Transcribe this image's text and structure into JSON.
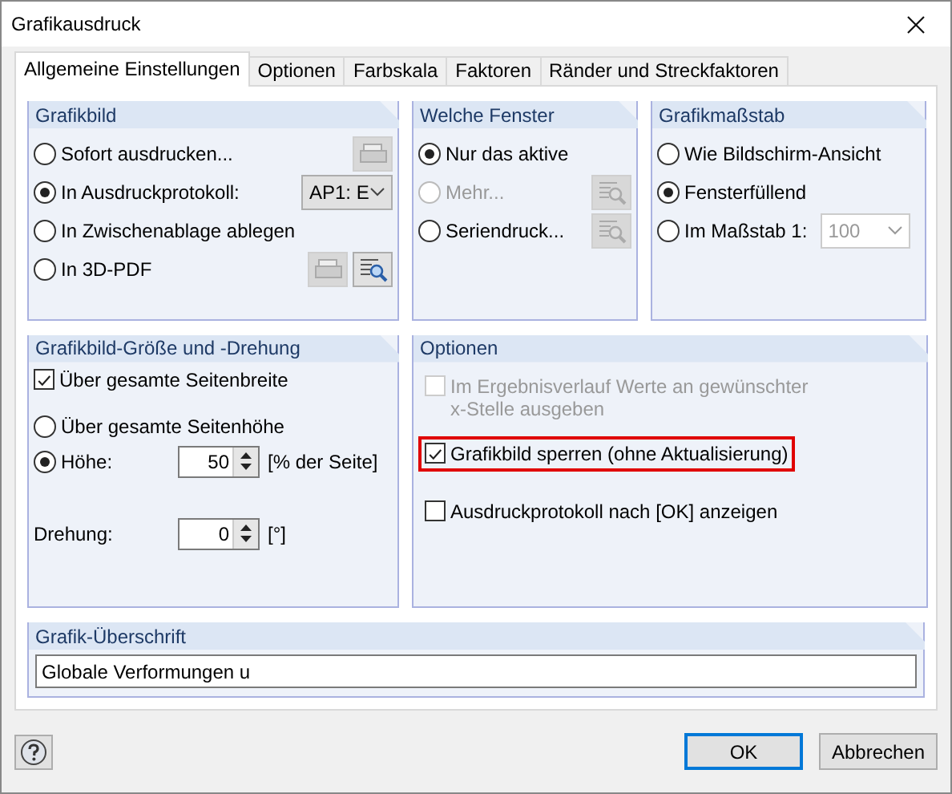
{
  "window": {
    "title": "Grafikausdruck"
  },
  "tabs": [
    {
      "label": "Allgemeine Einstellungen",
      "selected": true
    },
    {
      "label": "Optionen",
      "selected": false
    },
    {
      "label": "Farbskala",
      "selected": false
    },
    {
      "label": "Faktoren",
      "selected": false
    },
    {
      "label": "Ränder und Streckfaktoren",
      "selected": false
    }
  ],
  "grafikbild": {
    "title": "Grafikbild",
    "report_select": {
      "value": "AP1: E"
    },
    "options": [
      {
        "label": "Sofort ausdrucken...",
        "selected": false,
        "tools": [
          {
            "kind": "print",
            "disabled": true
          }
        ]
      },
      {
        "label": "In Ausdruckprotokoll:",
        "selected": true,
        "tools": [
          {
            "kind": "select"
          }
        ]
      },
      {
        "label": "In Zwischenablage ablegen",
        "selected": false
      },
      {
        "label": "In 3D-PDF",
        "selected": false,
        "tools": [
          {
            "kind": "print",
            "disabled": true
          },
          {
            "kind": "preview",
            "disabled": false
          }
        ]
      }
    ]
  },
  "welche_fenster": {
    "title": "Welche Fenster",
    "options": [
      {
        "label": "Nur das aktive",
        "selected": true,
        "disabled": false
      },
      {
        "label": "Mehr...",
        "selected": false,
        "disabled": true,
        "tools": [
          {
            "kind": "preview",
            "disabled": true
          }
        ]
      },
      {
        "label": "Seriendruck...",
        "selected": false,
        "disabled": false,
        "tools": [
          {
            "kind": "preview",
            "disabled": true
          }
        ]
      }
    ]
  },
  "grafikmassstab": {
    "title": "Grafikmaßstab",
    "scale_select": {
      "value": "100",
      "disabled": true
    },
    "options": [
      {
        "label": "Wie Bildschirm-Ansicht",
        "selected": false
      },
      {
        "label": "Fensterfüllend",
        "selected": true
      },
      {
        "label": "Im Maßstab 1:",
        "selected": false
      }
    ]
  },
  "groesse": {
    "title": "Grafikbild-Größe und -Drehung",
    "full_width": {
      "label": "Über gesamte Seitenbreite",
      "checked": true
    },
    "options": [
      {
        "label": "Über gesamte Seitenhöhe",
        "selected": false
      },
      {
        "label": "Höhe:",
        "selected": true
      }
    ],
    "height": {
      "value": "50",
      "unit": "[% der Seite]"
    },
    "rotation": {
      "label": "Drehung:",
      "value": "0",
      "unit": "[°]"
    }
  },
  "optionen": {
    "title": "Optionen",
    "items": [
      {
        "label": "Im Ergebnisverlauf Werte an gewünschter x-Stelle ausgeben",
        "checked": false,
        "disabled": true,
        "highlighted": false
      },
      {
        "label": "Grafikbild sperren (ohne Aktualisierung)",
        "checked": true,
        "disabled": false,
        "highlighted": true
      },
      {
        "label": "Ausdruckprotokoll nach [OK] anzeigen",
        "checked": false,
        "disabled": false,
        "highlighted": false
      }
    ]
  },
  "ueberschrift": {
    "title": "Grafik-Überschrift",
    "value": "Globale Verformungen u"
  },
  "buttons": [
    {
      "label": "OK",
      "default": true
    },
    {
      "label": "Abbrechen",
      "default": false
    }
  ]
}
